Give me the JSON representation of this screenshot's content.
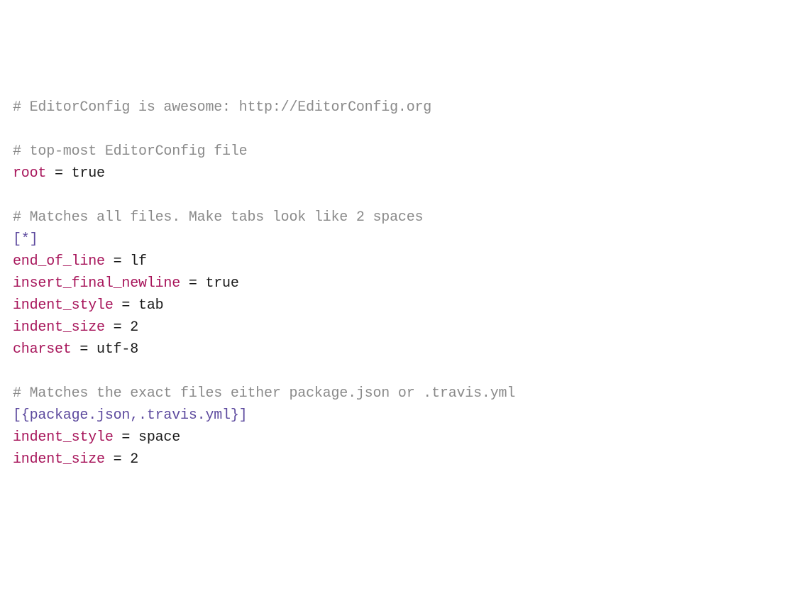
{
  "lines": {
    "c1": "# EditorConfig is awesome: http://EditorConfig.org",
    "blank": "",
    "c2": "# top-most EditorConfig file",
    "k_root": "root",
    "eq": " = ",
    "v_true": "true",
    "c3": "# Matches all files. Make tabs look like 2 spaces",
    "s1": "[*]",
    "k_eol": "end_of_line",
    "v_lf": "lf",
    "k_ifn": "insert_final_newline",
    "k_istyle": "indent_style",
    "v_tab": "tab",
    "k_isize": "indent_size",
    "v_2": "2",
    "k_charset": "charset",
    "v_utf8": "utf-8",
    "c4": "# Matches the exact files either package.json or .travis.yml",
    "s2": "[{package.json,.travis.yml}]",
    "v_space": "space"
  }
}
